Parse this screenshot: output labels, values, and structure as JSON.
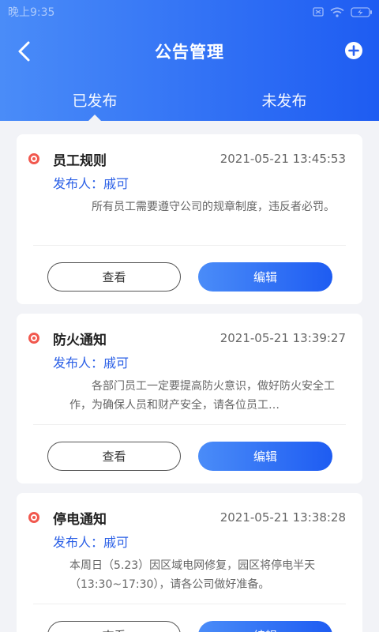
{
  "status_bar": {
    "time": "晚上9:35"
  },
  "header": {
    "title": "公告管理",
    "tabs": [
      {
        "label": "已发布",
        "active": true
      },
      {
        "label": "未发布",
        "active": false
      }
    ]
  },
  "notices": [
    {
      "title": "员工规则",
      "time": "2021-05-21 13:45:53",
      "publisher": "发布人：戚可",
      "content": "所有员工需要遵守公司的规章制度，违反者必罚。",
      "view_label": "查看",
      "edit_label": "编辑"
    },
    {
      "title": "防火通知",
      "time": "2021-05-21 13:39:27",
      "publisher": "发布人：戚可",
      "content": "各部门员工一定要提高防火意识，做好防火安全工作，为确保人员和财产安全，请各位员工…",
      "view_label": "查看",
      "edit_label": "编辑"
    },
    {
      "title": "停电通知",
      "time": "2021-05-21 13:38:28",
      "publisher": "发布人：戚可",
      "content": "本周日（5.23）因区域电网修复，园区将停电半天（13:30~17:30），请各公司做好准备。",
      "view_label": "查看",
      "edit_label": "编辑"
    }
  ],
  "colors": {
    "primary": "#1e5cf2",
    "primary_light": "#4a8cf8",
    "dot": "#f1584e",
    "publisher": "#2a5fe6"
  }
}
